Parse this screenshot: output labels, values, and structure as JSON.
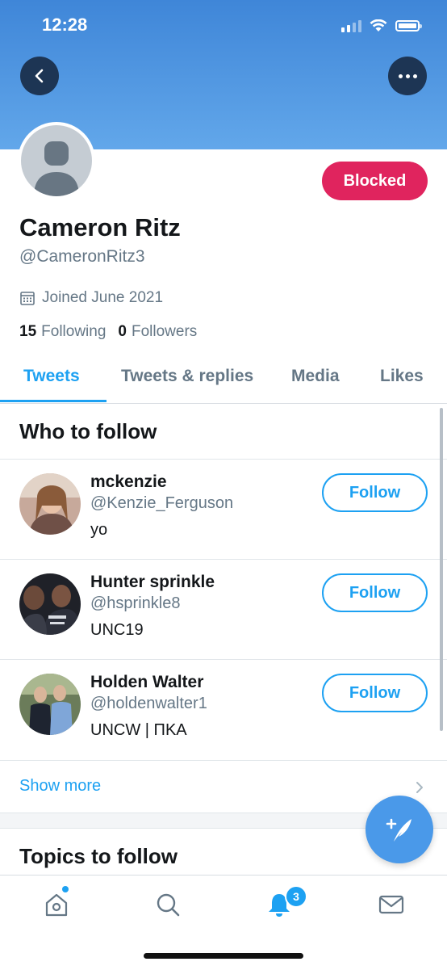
{
  "status_bar": {
    "time": "12:28"
  },
  "profile": {
    "display_name": "Cameron Ritz",
    "handle": "@CameronRitz3",
    "joined": "Joined June 2021",
    "following_count": "15",
    "following_label": "Following",
    "followers_count": "0",
    "followers_label": "Followers",
    "blocked_label": "Blocked"
  },
  "tabs": [
    {
      "label": "Tweets",
      "active": true
    },
    {
      "label": "Tweets & replies",
      "active": false
    },
    {
      "label": "Media",
      "active": false
    },
    {
      "label": "Likes",
      "active": false
    }
  ],
  "who_to_follow": {
    "title": "Who to follow",
    "users": [
      {
        "name": "mckenzie",
        "handle": "@Kenzie_Ferguson",
        "bio": "yo",
        "button": "Follow"
      },
      {
        "name": "Hunter sprinkle",
        "handle": "@hsprinkle8",
        "bio": "UNC19",
        "button": "Follow"
      },
      {
        "name": "Holden Walter",
        "handle": "@holdenwalter1",
        "bio": "UNCW | ΠΚΑ",
        "button": "Follow"
      }
    ],
    "show_more": "Show more"
  },
  "topics_to_follow": {
    "title": "Topics to follow"
  },
  "bottom_nav": {
    "notifications_badge": "3"
  },
  "colors": {
    "accent": "#1da1f2",
    "blocked": "#e0245e",
    "banner": "#4a94e0"
  }
}
